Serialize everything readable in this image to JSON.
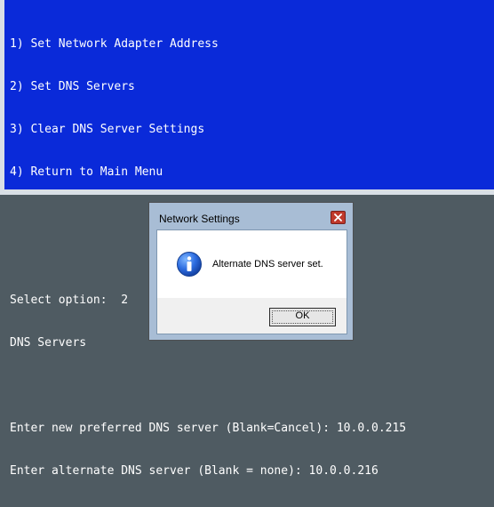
{
  "console": {
    "lines": [
      "1) Set Network Adapter Address",
      "2) Set DNS Servers",
      "3) Clear DNS Server Settings",
      "4) Return to Main Menu",
      "",
      "",
      "Select option:  2",
      "DNS Servers",
      "",
      "Enter new preferred DNS server (Blank=Cancel): 10.0.0.215",
      "Enter alternate DNS server (Blank = none): 10.0.0.216"
    ],
    "background_color": "#0a2ad9",
    "text_color": "#ffffff"
  },
  "dialog": {
    "title": "Network Settings",
    "icon": "information-icon",
    "message": "Alternate DNS server set.",
    "ok_label": "OK",
    "close_icon": "close-icon",
    "accent_color": "#c0392b"
  }
}
